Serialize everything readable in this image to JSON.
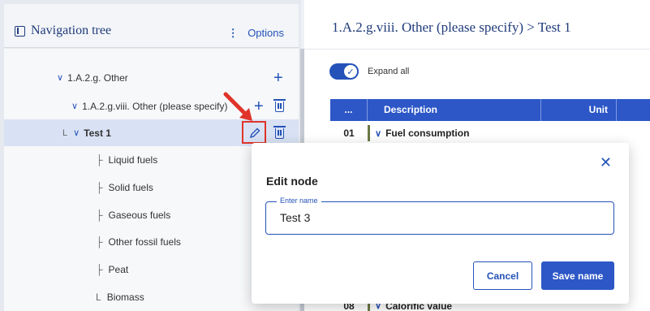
{
  "navigation": {
    "title": "Navigation tree",
    "options_label": "Options",
    "options_icon": "⋮",
    "nodes": [
      {
        "label": "1.A.2.g. Other",
        "chevron": "∨"
      },
      {
        "label": "1.A.2.g.viii. Other (please specify)",
        "chevron": "∨"
      },
      {
        "label": "Test 1",
        "prefix": "L",
        "chevron": "∨"
      },
      {
        "label": "Liquid fuels",
        "prefix": "├"
      },
      {
        "label": "Solid fuels",
        "prefix": "├"
      },
      {
        "label": "Gaseous fuels",
        "prefix": "├"
      },
      {
        "label": "Other fossil fuels",
        "prefix": "├"
      },
      {
        "label": "Peat",
        "prefix": "├"
      },
      {
        "label": "Biomass",
        "prefix": "L"
      }
    ]
  },
  "main": {
    "title": "1.A.2.g.viii. Other (please specify) > Test 1",
    "expand_all_label": "Expand all",
    "expand_all_on": true,
    "table": {
      "headers": [
        "...",
        "Description",
        "Unit"
      ],
      "rows": [
        {
          "index": "01",
          "chevron": "∨",
          "description": "Fuel consumption"
        },
        {
          "index": "08",
          "chevron": "∨",
          "description": "Calorific value"
        }
      ]
    }
  },
  "modal": {
    "title": "Edit node",
    "close_icon": "✕",
    "field_label": "Enter name",
    "field_value": "Test 3",
    "cancel_label": "Cancel",
    "save_label": "Save name"
  },
  "colors": {
    "accent": "#2d57c7",
    "highlight": "#e0342a"
  }
}
